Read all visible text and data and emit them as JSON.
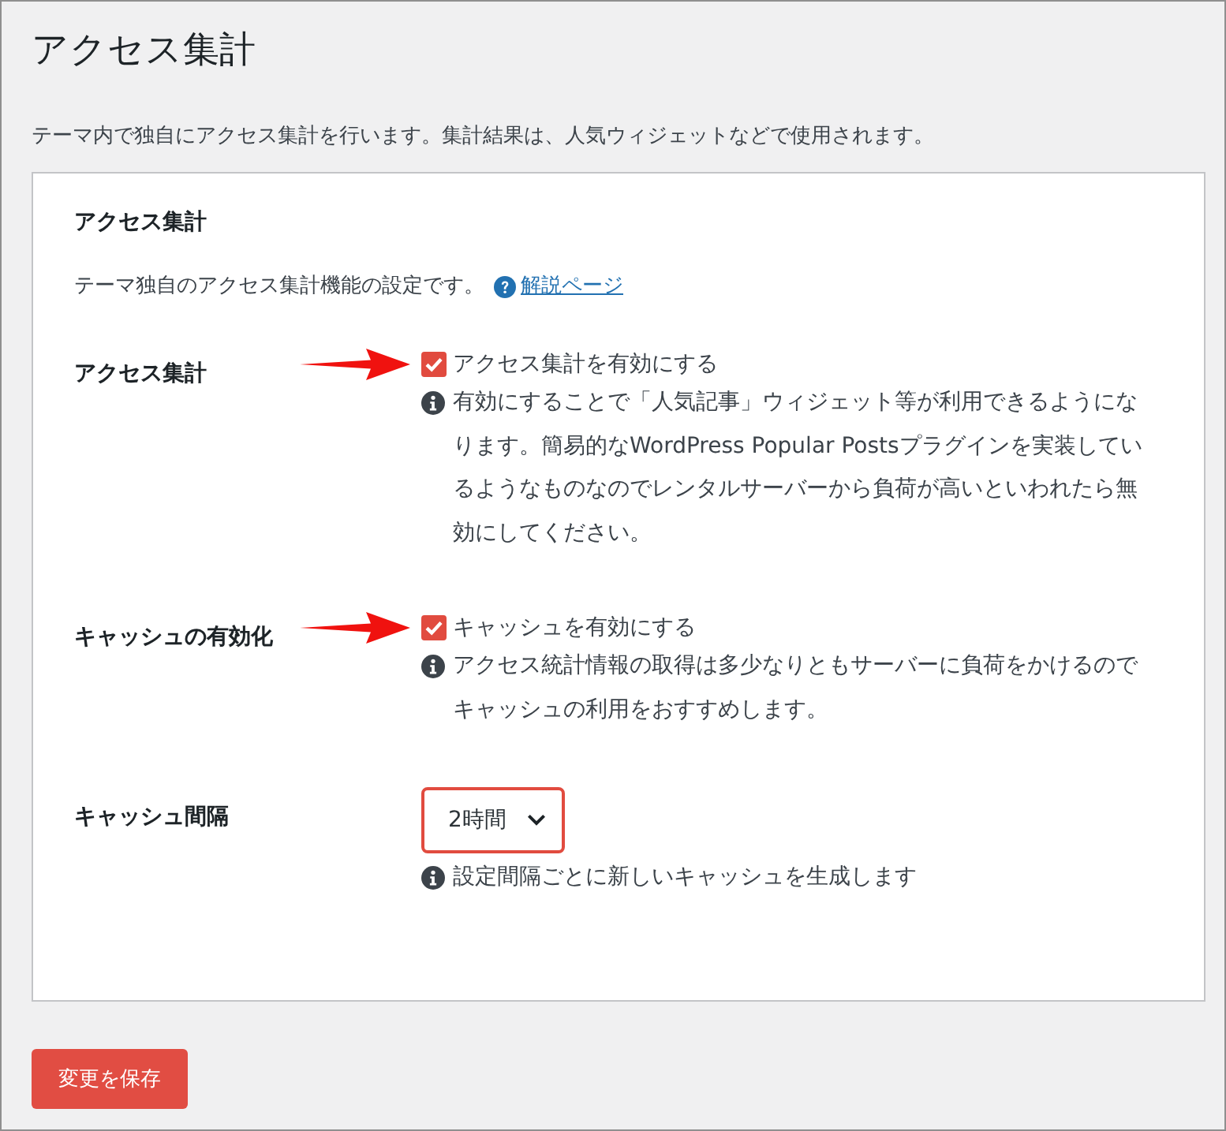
{
  "page": {
    "title": "アクセス集計",
    "description": "テーマ内で独自にアクセス集計を行います。集計結果は、人気ウィジェットなどで使用されます。"
  },
  "card": {
    "heading": "アクセス集計",
    "description": "テーマ独自のアクセス集計機能の設定です。",
    "help_link": "解説ページ"
  },
  "settings": [
    {
      "kind": "checkbox",
      "label": "アクセス集計",
      "option": "アクセス集計を有効にする",
      "checked": true,
      "marked": true,
      "note": "有効にすることで「人気記事」ウィジェット等が利用できるようになります。簡易的なWordPress Popular Postsプラグインを実装しているようなものなのでレンタルサーバーから負荷が高いといわれたら無効にしてください。"
    },
    {
      "kind": "checkbox",
      "label": "キャッシュの有効化",
      "option": "キャッシュを有効にする",
      "checked": true,
      "marked": true,
      "note": "アクセス統計情報の取得は多少なりともサーバーに負荷をかけるのでキャッシュの利用をおすすめします。"
    },
    {
      "kind": "select",
      "label": "キャッシュ間隔",
      "value": "2時間",
      "marked": true,
      "note": "設定間隔ごとに新しいキャッシュを生成します"
    }
  ],
  "save_button": "変更を保存"
}
